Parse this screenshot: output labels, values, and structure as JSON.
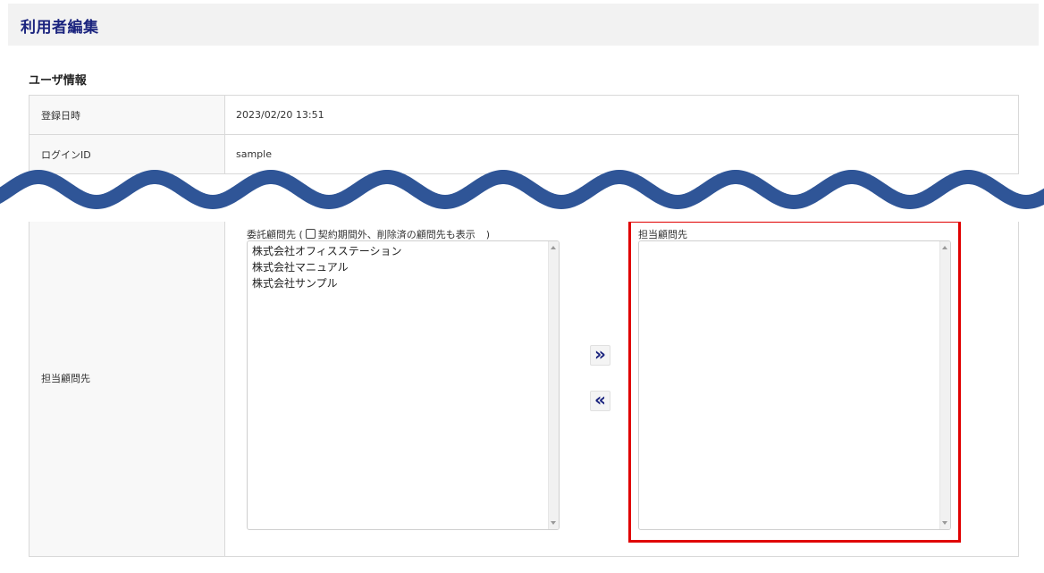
{
  "page": {
    "title": "利用者編集"
  },
  "section": {
    "title": "ユーザ情報"
  },
  "rows": [
    {
      "label": "登録日時",
      "value": "2023/02/20 13:51"
    },
    {
      "label": "ログインID",
      "value": "sample"
    }
  ],
  "assignment": {
    "label": "担当顧問先",
    "left_list": {
      "caption_prefix": "委託顧問先 (",
      "checkbox_label": "契約期間外、削除済の顧問先も表示",
      "caption_suffix": ")",
      "options": [
        "株式会社オフィスステーション",
        "株式会社マニュアル",
        "株式会社サンプル"
      ]
    },
    "right_list": {
      "caption": "担当顧問先",
      "options": []
    },
    "add_button": "»",
    "remove_button": "«"
  },
  "colors": {
    "accent": "#1a237e",
    "highlight": "#e00000",
    "wave": "#2f5597"
  }
}
